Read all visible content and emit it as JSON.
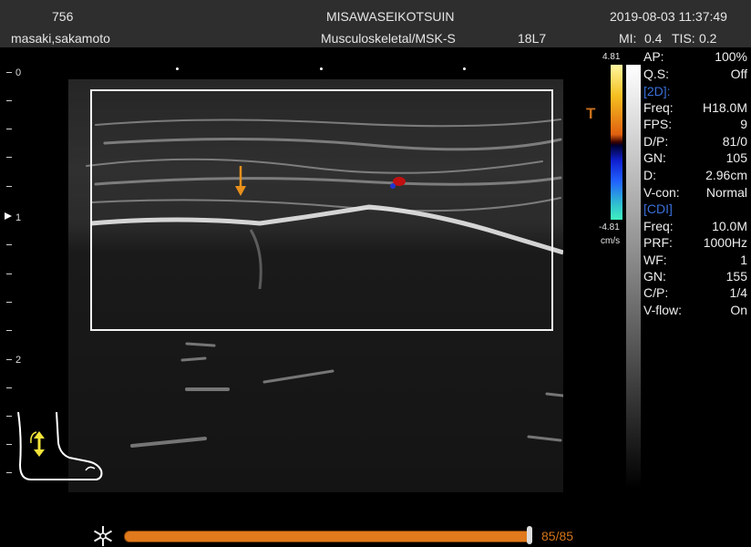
{
  "header": {
    "patient_id": "756",
    "patient_name": "masaki,sakamoto",
    "institution": "MISAWASEIKOTSUIN",
    "preset": "Musculoskeletal/MSK-S",
    "probe": "18L7",
    "datetime": "2019-08-03 11:37:49",
    "mi_label": "MI:",
    "mi_value": "0.4",
    "tis_label": "TIS:",
    "tis_value": "0.2"
  },
  "depth_scale": {
    "labels": [
      "0",
      "1",
      "2"
    ]
  },
  "color_bar": {
    "max": "4.81",
    "min": "-4.81",
    "unit": "cm/s",
    "marker": "T"
  },
  "params": {
    "ap": {
      "k": "AP:",
      "v": "100%"
    },
    "qs": {
      "k": "Q.S:",
      "v": "Off"
    },
    "section_2d": "[2D]:",
    "freq2d": {
      "k": "Freq:",
      "v": "H18.0M"
    },
    "fps": {
      "k": "FPS:",
      "v": "9"
    },
    "dp": {
      "k": "D/P:",
      "v": "81/0"
    },
    "gn2d": {
      "k": "GN:",
      "v": "105"
    },
    "d": {
      "k": "D:",
      "v": "2.96cm"
    },
    "vcon": {
      "k": "V-con:",
      "v": "Normal"
    },
    "section_cdi": "[CDI]",
    "freqcdi": {
      "k": "Freq:",
      "v": "10.0M"
    },
    "prf": {
      "k": "PRF:",
      "v": "1000Hz"
    },
    "wf": {
      "k": "WF:",
      "v": "1"
    },
    "gncdi": {
      "k": "GN:",
      "v": "155"
    },
    "cp": {
      "k": "C/P:",
      "v": "1/4"
    },
    "vflow": {
      "k": "V-flow:",
      "v": "On"
    }
  },
  "cine": {
    "frame_text": "85/85",
    "progress": 1.0
  },
  "icons": {
    "body_mark": "foot-bodymark-icon",
    "freeze": "snowflake-icon",
    "annotation": "down-arrow-icon"
  },
  "colors": {
    "accent_orange": "#e8901c",
    "section_blue": "#3a6fd8",
    "bodymark_arrow": "#f2e23a"
  }
}
